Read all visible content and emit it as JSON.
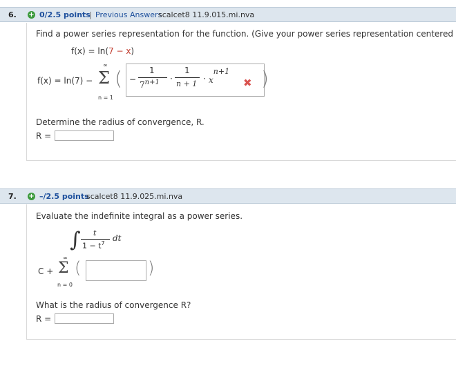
{
  "q6": {
    "number": "6.",
    "points": "0/2.5 points",
    "separator": "|",
    "previous_answers": "Previous Answers",
    "code": "scalcet8 11.9.015.mi.nva",
    "prompt": "Find a power series representation for the function. (Give your power series representation centered at x",
    "fx_label": "f(x) = ln(",
    "fx_arg": "7 − x",
    "fx_close": ")",
    "series_lhs": "f(x) = ln(7) −",
    "sum_top": "∞",
    "sum_bottom": "n = 1",
    "sigma": "Σ",
    "answer": {
      "sign": "−",
      "frac1_num": "1",
      "frac1_den_base": "7",
      "frac1_den_exp": "n+1",
      "dot1": "·",
      "frac2_num": "1",
      "frac2_den": "n + 1",
      "dot2": "·",
      "x": "x",
      "x_exp": "n+1"
    },
    "status": "incorrect",
    "wrong_icon": "✖",
    "radius_prompt": "Determine the radius of convergence, R.",
    "radius_label": "R ="
  },
  "q7": {
    "number": "7.",
    "points": "–/2.5 points",
    "code": "scalcet8 11.9.025.mi.nva",
    "prompt": "Evaluate the indefinite integral as a power series.",
    "integral_sign": "∫",
    "int_num": "t",
    "int_den": "1 − t",
    "int_den_exp": "7",
    "dt": "dt",
    "c_plus": "C +",
    "sum_top": "∞",
    "sum_bottom": "n = 0",
    "sigma": "Σ",
    "radius_prompt": "What is the radius of convergence R?",
    "radius_label": "R ="
  },
  "colors": {
    "header_bg": "#dde6ee",
    "points_blue": "#1d4f9c",
    "plus_green": "#3c9a3c",
    "error_red": "#d9534f"
  }
}
